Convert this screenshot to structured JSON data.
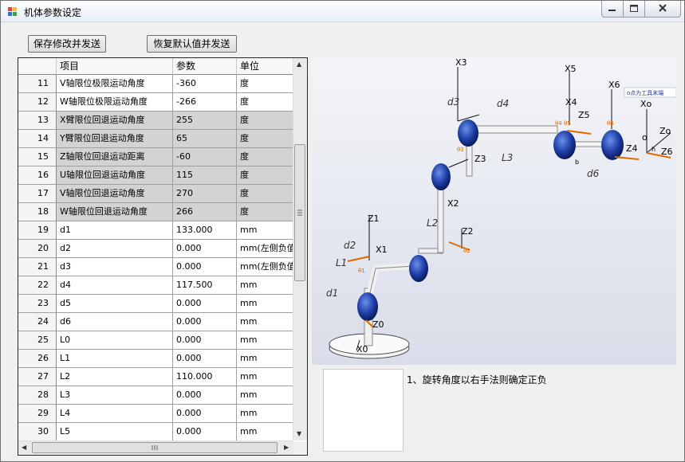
{
  "window": {
    "title": "机体参数设定"
  },
  "toolbar": {
    "save_label": "保存修改并发送",
    "restore_label": "恢复默认值并发送"
  },
  "grid": {
    "columns": [
      "项目",
      "参数",
      "单位"
    ],
    "rows": [
      {
        "num": "11",
        "item": "V轴限位极限运动角度",
        "value": "-360",
        "unit": "度",
        "gray": false
      },
      {
        "num": "12",
        "item": "W轴限位极限运动角度",
        "value": "-266",
        "unit": "度",
        "gray": false
      },
      {
        "num": "13",
        "item": "X臂限位回退运动角度",
        "value": "255",
        "unit": "度",
        "gray": true
      },
      {
        "num": "14",
        "item": "Y臂限位回退运动角度",
        "value": "65",
        "unit": "度",
        "gray": true
      },
      {
        "num": "15",
        "item": "Z轴限位回退运动距离",
        "value": "-60",
        "unit": "度",
        "gray": true
      },
      {
        "num": "16",
        "item": "U轴限位回退运动角度",
        "value": "115",
        "unit": "度",
        "gray": true
      },
      {
        "num": "17",
        "item": "V轴限位回退运动角度",
        "value": "270",
        "unit": "度",
        "gray": true
      },
      {
        "num": "18",
        "item": "W轴限位回退运动角度",
        "value": "266",
        "unit": "度",
        "gray": true
      },
      {
        "num": "19",
        "item": "d1",
        "value": "133.000",
        "unit": "mm",
        "gray": false
      },
      {
        "num": "20",
        "item": "d2",
        "value": "0.000",
        "unit": "mm(左侧负值",
        "gray": false
      },
      {
        "num": "21",
        "item": "d3",
        "value": "0.000",
        "unit": "mm(左侧负值",
        "gray": false
      },
      {
        "num": "22",
        "item": "d4",
        "value": "117.500",
        "unit": "mm",
        "gray": false
      },
      {
        "num": "23",
        "item": "d5",
        "value": "0.000",
        "unit": "mm",
        "gray": false
      },
      {
        "num": "24",
        "item": "d6",
        "value": "0.000",
        "unit": "mm",
        "gray": false
      },
      {
        "num": "25",
        "item": "L0",
        "value": "0.000",
        "unit": "mm",
        "gray": false
      },
      {
        "num": "26",
        "item": "L1",
        "value": "0.000",
        "unit": "mm",
        "gray": false
      },
      {
        "num": "27",
        "item": "L2",
        "value": "110.000",
        "unit": "mm",
        "gray": false
      },
      {
        "num": "28",
        "item": "L3",
        "value": "0.000",
        "unit": "mm",
        "gray": false
      },
      {
        "num": "29",
        "item": "L4",
        "value": "0.000",
        "unit": "mm",
        "gray": false
      },
      {
        "num": "30",
        "item": "L5",
        "value": "0.000",
        "unit": "mm",
        "gray": false
      }
    ]
  },
  "diagram": {
    "labels": {
      "x3": "X3",
      "x5": "X5",
      "x6": "X6",
      "x4": "X4",
      "z5": "Z5",
      "z3": "Z3",
      "z4": "Z4",
      "z6": "Z6",
      "x2": "X2",
      "z1": "Z1",
      "x1": "X1",
      "z2": "Z2",
      "z0": "Z0",
      "x0": "X0",
      "xo": "Xo",
      "zo": "Zo",
      "o": "o",
      "h": "h",
      "b": "b",
      "d1": "d1",
      "d2": "d2",
      "d3": "d3",
      "d4": "d4",
      "d6": "d6",
      "l1": "L1",
      "l2": "L2",
      "l3": "L3",
      "th1": "θ1",
      "th2": "θ2",
      "th3": "θ3",
      "th45": "θ4 θ5",
      "th6": "θ6"
    },
    "tool_note": "o点为工具末端"
  },
  "note": "1、旋转角度以右手法则确定正负",
  "colors": {
    "gray_row": "#d3d3d3",
    "joint_blue": "#1f3fa8",
    "axis_label": "#e06a00"
  }
}
